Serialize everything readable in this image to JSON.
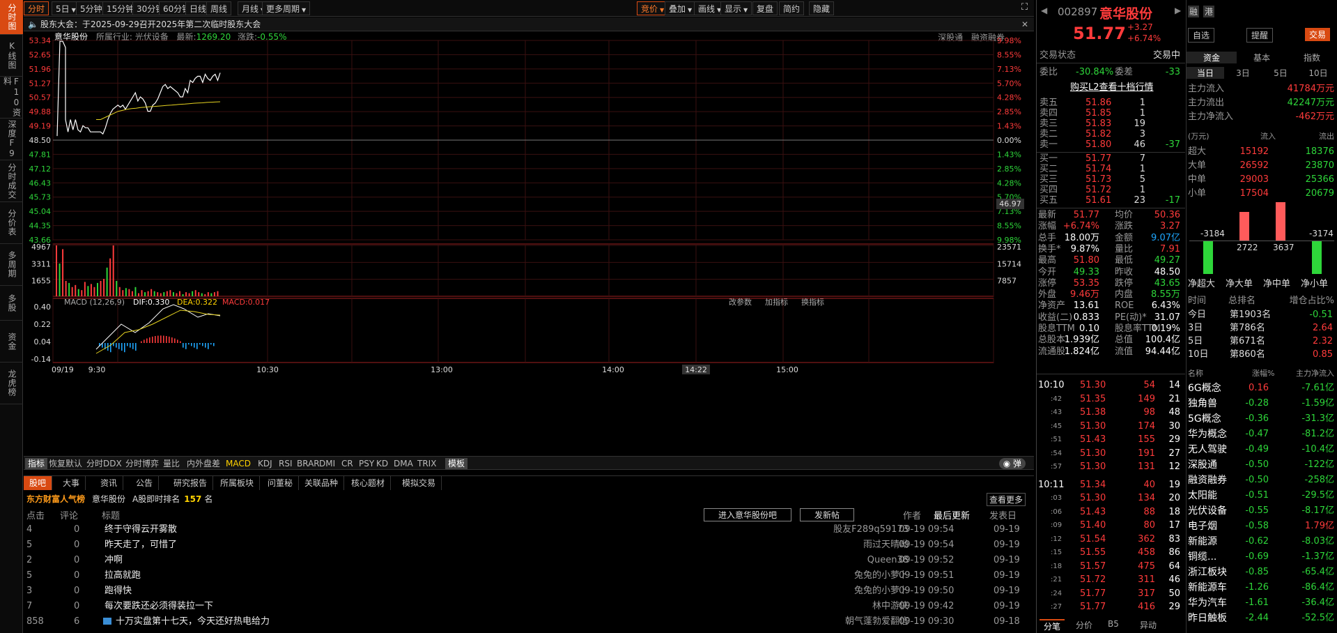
{
  "left_tabs": [
    "分时图",
    "K线图",
    "F10资料",
    "深度F9",
    "分时成交",
    "分价表",
    "多周期",
    "多股",
    "资金",
    "龙虎榜"
  ],
  "toolbar": [
    "分时",
    "5日",
    "5分钟",
    "15分钟",
    "30分钟",
    "60分钟",
    "日线",
    "周线",
    "月线",
    "更多周期",
    "竞价",
    "叠加",
    "画线",
    "显示",
    "复盘",
    "简约",
    "隐藏"
  ],
  "notice": "股东大会：于2025-09-29召开2025年第二次临时股东大会",
  "info": {
    "name": "意华股份",
    "industry": "所属行业: 光伏设备",
    "latest_label": "最新:",
    "latest": "1269.20",
    "chg_label": "涨跌:",
    "chg": "-0.55%",
    "shen": "深股通",
    "rzrq": "融资融券"
  },
  "chart_data": {
    "type": "line",
    "title": "",
    "price_axis": [
      "53.34",
      "52.65",
      "51.96",
      "51.27",
      "50.57",
      "49.88",
      "49.19",
      "48.50",
      "47.81",
      "47.12",
      "46.43",
      "45.73",
      "45.04",
      "44.35",
      "43.66"
    ],
    "pct_axis": [
      "9.98%",
      "8.55%",
      "7.13%",
      "5.70%",
      "4.28%",
      "2.85%",
      "1.43%",
      "0.00%",
      "1.43%",
      "2.85%",
      "4.28%",
      "5.70%",
      "7.13%",
      "8.55%",
      "9.98%"
    ],
    "ylim": [
      43.66,
      53.34
    ],
    "prev_close": 48.5,
    "cursor_label": "46.97",
    "time_labels": [
      "09/19",
      "9:30",
      "10:30",
      "13:00",
      "14:00",
      "14:22",
      "15:00"
    ],
    "price": [
      48.7,
      53.3,
      53.3,
      53.0,
      49.5,
      48.9,
      49.5,
      49.0,
      49.5,
      49.0,
      48.9,
      49.2,
      49.1,
      49.1,
      48.9,
      48.9,
      48.9,
      48.9,
      48.9,
      48.8,
      49.1,
      49.5,
      49.8,
      50.0,
      50.1,
      50.2,
      50.1,
      50.2,
      50.0,
      50.2,
      50.4,
      50.6,
      50.8,
      50.4,
      50.6,
      50.5,
      50.3,
      49.9,
      49.9,
      50.2,
      50.3,
      50.5,
      50.8,
      51.1,
      51.2,
      51.0,
      51.1,
      51.0,
      50.9,
      50.8,
      50.6,
      50.6,
      51.0,
      50.8,
      51.4,
      51.3,
      51.5,
      51.6,
      51.6,
      51.3,
      51.7,
      51.5,
      51.4,
      51.6,
      51.7,
      51.4,
      51.77
    ],
    "avg": [
      49.5,
      49.5,
      49.6,
      49.7,
      49.8,
      49.9,
      49.95,
      50.0,
      50.03,
      50.05,
      50.08,
      50.1,
      50.12,
      50.13,
      50.15,
      50.17,
      50.19,
      50.2,
      50.22,
      50.24,
      50.25,
      50.27,
      50.29,
      50.3,
      50.31,
      50.33,
      50.34,
      50.35,
      50.36
    ],
    "volume_axis": [
      "4967",
      "3311",
      "1655"
    ],
    "volume_axis_r": [
      "23571",
      "15714",
      "7857"
    ],
    "volume": [
      4967,
      3200,
      4600,
      1500,
      1300,
      900,
      1100,
      700,
      600,
      1400,
      1000,
      1200,
      900,
      1300,
      1500,
      1700,
      2800,
      3700,
      4967,
      1500,
      900,
      600,
      800,
      700,
      500,
      900,
      300,
      600,
      400,
      500,
      700,
      500,
      400,
      300,
      400,
      500,
      600,
      400,
      300,
      500,
      200,
      400,
      300,
      500,
      600,
      400,
      300,
      200,
      400,
      300,
      400,
      500
    ],
    "macd_axis": [
      "0.40",
      "0.22",
      "0.04",
      "-0.14"
    ],
    "macd_label": "MACD (12,26,9)",
    "dif": "DIF:0.330",
    "dea": "DEA:0.322",
    "macd": "MACD:0.017",
    "macd_btns": [
      "改参数",
      "加指标",
      "换指标"
    ]
  },
  "ind_tabs": [
    "指标",
    "恢复默认",
    "分时DDX",
    "分时博弈",
    "量比",
    "内外盘差",
    "MACD",
    "KDJ",
    "RSI",
    "BRAR",
    "DMI",
    "CR",
    "PSY",
    "KD",
    "DMA",
    "TRIX",
    "模板"
  ],
  "guba": {
    "tabs": [
      "股吧",
      "大事",
      "资讯",
      "公告",
      "研究报告",
      "所属板块",
      "问董秘",
      "关联品种",
      "核心题材",
      "模拟交易"
    ],
    "rank_title": "东方财富人气榜",
    "stock": "意华股份",
    "rank_text": "A股即时排名",
    "rank": "157",
    "rank_unit": "名",
    "more": "查看更多",
    "headers": [
      "点击",
      "评论",
      "标题",
      "作者",
      "最后更新",
      "发表日"
    ],
    "enter": "进入意华股份吧",
    "post": "发新帖",
    "rows": [
      [
        "4",
        "0",
        "终于守得云开雾散",
        "股友F289q59173",
        "09-19 09:54",
        "09-19"
      ],
      [
        "5",
        "0",
        "昨天走了，可惜了",
        "雨过天晴呦",
        "09-19 09:54",
        "09-19"
      ],
      [
        "2",
        "0",
        "冲啊",
        "Queen38",
        "09-19 09:52",
        "09-19"
      ],
      [
        "5",
        "0",
        "拉高就跑",
        "兔兔的小萝卜",
        "09-19 09:51",
        "09-19"
      ],
      [
        "3",
        "0",
        "跑得快",
        "兔兔的小萝卜",
        "09-19 09:50",
        "09-19"
      ],
      [
        "7",
        "0",
        "每次要跌还必须得装拉一下",
        "林中游侠",
        "09-19 09:42",
        "09-19"
      ],
      [
        "858",
        "6",
        "十万实盘第十七天，今天还好热电给力",
        "朝气蓬勃爱翻信",
        "09-19 09:30",
        "09-18"
      ]
    ]
  },
  "quote": {
    "code": "002897",
    "name": "意华股份",
    "price": "51.77",
    "chg": "+3.27",
    "pct": "+6.74%",
    "btns": [
      "融",
      "港",
      "自选",
      "提醒",
      "交易"
    ],
    "status_label": "交易状态",
    "status": "交易中",
    "weibi_label": "委比",
    "weibi": "-30.84%",
    "weicha_label": "委差",
    "weicha": "-33",
    "l2": "购买L2查看十档行情",
    "asks": [
      [
        "卖五",
        "51.86",
        "1",
        ""
      ],
      [
        "卖四",
        "51.85",
        "1",
        ""
      ],
      [
        "卖三",
        "51.83",
        "19",
        ""
      ],
      [
        "卖二",
        "51.82",
        "3",
        ""
      ],
      [
        "卖一",
        "51.80",
        "46",
        "-37"
      ]
    ],
    "bids": [
      [
        "买一",
        "51.77",
        "7",
        ""
      ],
      [
        "买二",
        "51.74",
        "1",
        ""
      ],
      [
        "买三",
        "51.73",
        "5",
        ""
      ],
      [
        "买四",
        "51.72",
        "1",
        ""
      ],
      [
        "买五",
        "51.61",
        "23",
        "-17"
      ]
    ],
    "stats": [
      [
        "最新",
        "51.77",
        "均价",
        "50.36"
      ],
      [
        "涨幅",
        "+6.74%",
        "涨跌",
        "3.27"
      ],
      [
        "总手",
        "18.00万",
        "金额",
        "9.07亿"
      ],
      [
        "换手*",
        "9.87%",
        "量比",
        "7.91"
      ],
      [
        "最高",
        "51.80",
        "最低",
        "49.27"
      ],
      [
        "今开",
        "49.33",
        "昨收",
        "48.50"
      ],
      [
        "涨停",
        "53.35",
        "跌停",
        "43.65"
      ],
      [
        "外盘",
        "9.46万",
        "内盘",
        "8.55万"
      ],
      [
        "净资产",
        "13.61",
        "ROE",
        "6.43%"
      ],
      [
        "收益(二)",
        "0.833",
        "PE(动)*",
        "31.07"
      ],
      [
        "股息TTM",
        "0.10",
        "股息率TTM",
        "0.19%"
      ],
      [
        "总股本",
        "1.939亿",
        "总值",
        "100.4亿"
      ],
      [
        "流通股",
        "1.824亿",
        "流值",
        "94.44亿"
      ]
    ],
    "ticks": [
      [
        "10:10",
        "51.30",
        "54",
        "14"
      ],
      [
        ":42",
        "51.35",
        "149",
        "21"
      ],
      [
        ":43",
        "51.38",
        "98",
        "48"
      ],
      [
        ":45",
        "51.30",
        "174",
        "30"
      ],
      [
        ":51",
        "51.43",
        "155",
        "29"
      ],
      [
        ":54",
        "51.30",
        "191",
        "27"
      ],
      [
        ":57",
        "51.30",
        "131",
        "12"
      ],
      [
        "10:11",
        "51.34",
        "40",
        "19"
      ],
      [
        ":03",
        "51.30",
        "134",
        "20"
      ],
      [
        ":06",
        "51.43",
        "88",
        "18"
      ],
      [
        ":09",
        "51.40",
        "80",
        "17"
      ],
      [
        ":12",
        "51.54",
        "362",
        "83"
      ],
      [
        ":15",
        "51.55",
        "458",
        "86"
      ],
      [
        ":18",
        "51.57",
        "475",
        "64"
      ],
      [
        ":21",
        "51.72",
        "311",
        "46"
      ],
      [
        ":24",
        "51.77",
        "317",
        "50"
      ],
      [
        ":27",
        "51.77",
        "416",
        "29"
      ]
    ],
    "bottom_tabs": [
      "分笔",
      "分价",
      "B5",
      "异动"
    ]
  },
  "fund": {
    "tabs": [
      "资金",
      "基本",
      "指数"
    ],
    "periods": [
      "当日",
      "3日",
      "5日",
      "10日"
    ],
    "flows": [
      [
        "主力流入",
        "41784万元"
      ],
      [
        "主力流出",
        "42247万元"
      ],
      [
        "主力净流入",
        "-462万元"
      ]
    ],
    "unit": "(万元)",
    "in": "流入",
    "out": "流出",
    "orders": [
      [
        "超大",
        "15192",
        "18376"
      ],
      [
        "大单",
        "26592",
        "23870"
      ],
      [
        "中单",
        "29003",
        "25366"
      ],
      [
        "小单",
        "17504",
        "20679"
      ]
    ],
    "net": [
      {
        "label": "净超大",
        "value": -3184
      },
      {
        "label": "净大单",
        "value": 2722
      },
      {
        "label": "净中单",
        "value": 3637
      },
      {
        "label": "净小单",
        "value": -3174
      }
    ],
    "rank_head": [
      "时间",
      "总排名",
      "增仓占比%"
    ],
    "ranks": [
      [
        "今日",
        "第1903名",
        "-0.51"
      ],
      [
        "3日",
        "第786名",
        "2.64"
      ],
      [
        "5日",
        "第671名",
        "2.32"
      ],
      [
        "10日",
        "第860名",
        "0.85"
      ]
    ],
    "sector_head": [
      "名称",
      "涨幅%",
      "主力净流入"
    ],
    "sectors": [
      [
        "6G概念",
        "0.16",
        "-7.61亿"
      ],
      [
        "独角兽",
        "-0.28",
        "-1.59亿"
      ],
      [
        "5G概念",
        "-0.36",
        "-31.3亿"
      ],
      [
        "华为概念",
        "-0.47",
        "-81.2亿"
      ],
      [
        "无人驾驶",
        "-0.49",
        "-10.4亿"
      ],
      [
        "深股通",
        "-0.50",
        "-122亿"
      ],
      [
        "融资融券",
        "-0.50",
        "-258亿"
      ],
      [
        "太阳能",
        "-0.51",
        "-29.5亿"
      ],
      [
        "光伏设备",
        "-0.55",
        "-8.17亿"
      ],
      [
        "电子烟",
        "-0.58",
        "1.79亿"
      ],
      [
        "新能源",
        "-0.62",
        "-8.03亿"
      ],
      [
        "铜缆...",
        "-0.69",
        "-1.37亿"
      ],
      [
        "浙江板块",
        "-0.85",
        "-65.4亿"
      ],
      [
        "新能源车",
        "-1.26",
        "-86.4亿"
      ],
      [
        "华为汽车",
        "-1.61",
        "-36.4亿"
      ],
      [
        "昨日触板",
        "-2.44",
        "-52.5亿"
      ]
    ]
  }
}
